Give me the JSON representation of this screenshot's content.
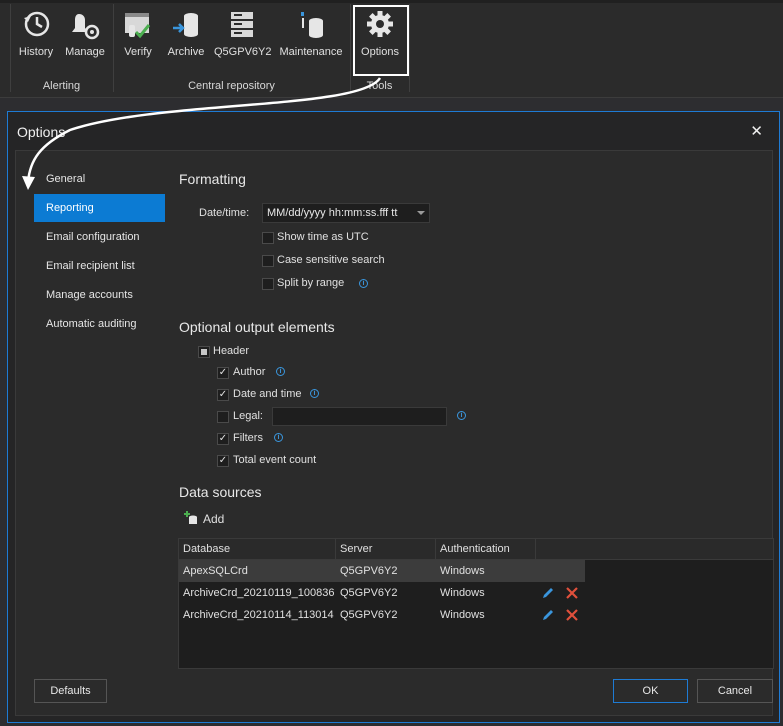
{
  "ribbon": {
    "buttons": [
      {
        "label": "History",
        "icon": "history-icon"
      },
      {
        "label": "Manage",
        "icon": "manage-icon"
      },
      {
        "label": "Verify",
        "icon": "verify-icon"
      },
      {
        "label": "Archive",
        "icon": "archive-icon"
      },
      {
        "label": "Q5GPV6Y2",
        "icon": "server-icon"
      },
      {
        "label": "Maintenance",
        "icon": "maintenance-icon"
      },
      {
        "label": "Options",
        "icon": "gear-icon"
      }
    ],
    "groups": [
      "Alerting",
      "Central repository",
      "Tools"
    ]
  },
  "dialog": {
    "title": "Options",
    "close": "✕",
    "nav": [
      "General",
      "Reporting",
      "Email configuration",
      "Email recipient list",
      "Manage accounts",
      "Automatic auditing"
    ],
    "active_nav": "Reporting",
    "formatting": {
      "title": "Formatting",
      "date_label": "Date/time:",
      "date_value": "MM/dd/yyyy hh:mm:ss.fff tt",
      "checks": [
        {
          "label": "Show time as UTC",
          "checked": false
        },
        {
          "label": "Case sensitive search",
          "checked": false
        },
        {
          "label": "Split by range",
          "checked": false
        }
      ]
    },
    "output": {
      "title": "Optional output elements",
      "header_label": "Header",
      "items": [
        {
          "label": "Author",
          "checked": true
        },
        {
          "label": "Date and time",
          "checked": true
        },
        {
          "label": "Legal:",
          "checked": false
        },
        {
          "label": "Filters",
          "checked": true
        },
        {
          "label": "Total event count",
          "checked": true
        }
      ]
    },
    "datasources": {
      "title": "Data sources",
      "add_label": "Add",
      "columns": [
        "Database",
        "Server",
        "Authentication"
      ],
      "rows": [
        {
          "database": "ApexSQLCrd",
          "server": "Q5GPV6Y2",
          "auth": "Windows"
        },
        {
          "database": "ArchiveCrd_20210119_100836",
          "server": "Q5GPV6Y2",
          "auth": "Windows"
        },
        {
          "database": "ArchiveCrd_20210114_113014",
          "server": "Q5GPV6Y2",
          "auth": "Windows"
        }
      ]
    },
    "buttons": {
      "defaults": "Defaults",
      "ok": "OK",
      "cancel": "Cancel"
    }
  }
}
